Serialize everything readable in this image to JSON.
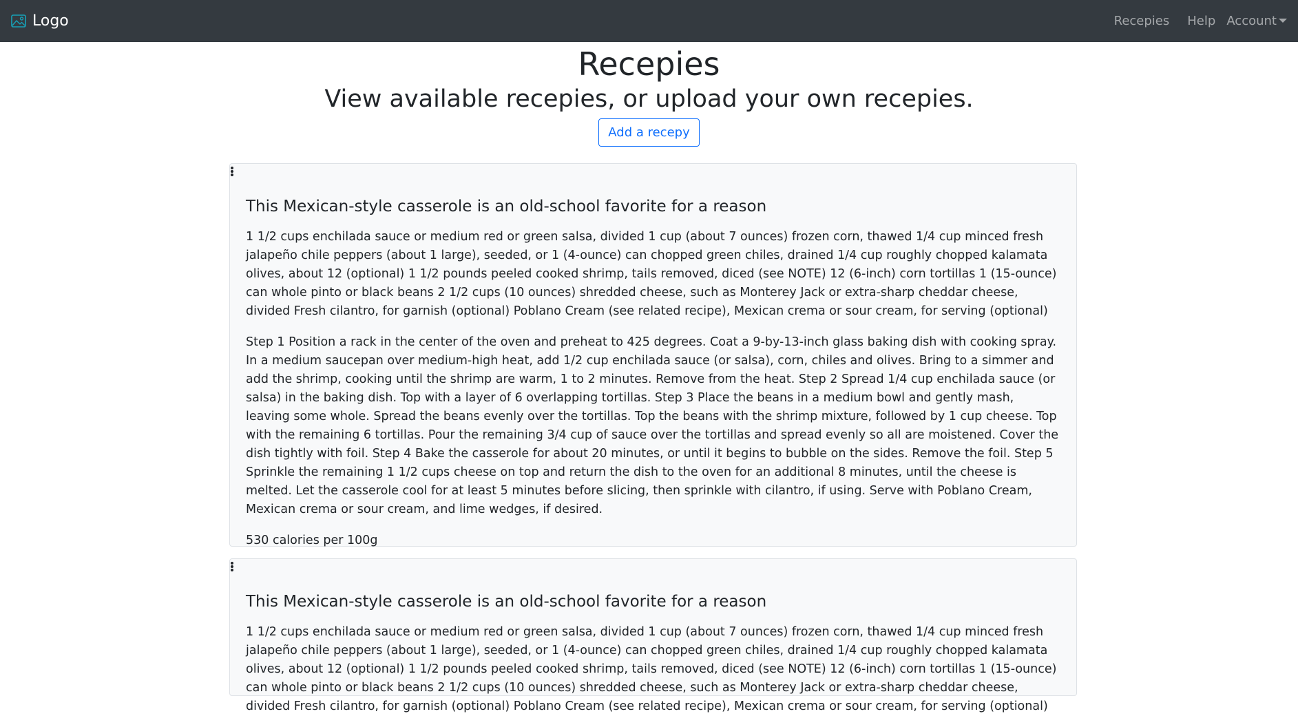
{
  "navbar": {
    "brand": "Logo",
    "links": [
      "Recepies",
      "Help",
      "Account"
    ]
  },
  "header": {
    "title": "Recepies",
    "subtitle": "View available recepies, or upload your own recepies.",
    "add_button": "Add a recepy"
  },
  "recipes": [
    {
      "title": "This Mexican-style casserole is an old-school favorite for a reason",
      "ingredients": "1 1/2 cups enchilada sauce or medium red or green salsa, divided 1 cup (about 7 ounces) frozen corn, thawed 1/4 cup minced fresh jalapeño chile peppers (about 1 large), seeded, or 1 (4-ounce) can chopped green chiles, drained 1/4 cup roughly chopped kalamata olives, about 12 (optional) 1 1/2 pounds peeled cooked shrimp, tails removed, diced (see NOTE) 12 (6-inch) corn tortillas 1 (15-ounce) can whole pinto or black beans 2 1/2 cups (10 ounces) shredded cheese, such as Monterey Jack or extra-sharp cheddar cheese, divided Fresh cilantro, for garnish (optional) Poblano Cream (see related recipe), Mexican crema or sour cream, for serving (optional)",
      "steps": "Step 1 Position a rack in the center of the oven and preheat to 425 degrees. Coat a 9-by-13-inch glass baking dish with cooking spray. In a medium saucepan over medium-high heat, add 1/2 cup enchilada sauce (or salsa), corn, chiles and olives. Bring to a simmer and add the shrimp, cooking until the shrimp are warm, 1 to 2 minutes. Remove from the heat. Step 2 Spread 1/4 cup enchilada sauce (or salsa) in the baking dish. Top with a layer of 6 overlapping tortillas. Step 3 Place the beans in a medium bowl and gently mash, leaving some whole. Spread the beans evenly over the tortillas. Top the beans with the shrimp mixture, followed by 1 cup cheese. Top with the remaining 6 tortillas. Pour the remaining 3/4 cup of sauce over the tortillas and spread evenly so all are moistened. Cover the dish tightly with foil. Step 4 Bake the casserole for about 20 minutes, or until it begins to bubble on the sides. Remove the foil. Step 5 Sprinkle the remaining 1 1/2 cups cheese on top and return the dish to the oven for an additional 8 minutes, until the cheese is melted. Let the casserole cool for at least 5 minutes before slicing, then sprinkle with cilantro, if using. Serve with Poblano Cream, Mexican crema or sour cream, and lime wedges, if desired.",
      "calories": "530 calories per 100g"
    },
    {
      "title": "This Mexican-style casserole is an old-school favorite for a reason",
      "ingredients": "1 1/2 cups enchilada sauce or medium red or green salsa, divided 1 cup (about 7 ounces) frozen corn, thawed 1/4 cup minced fresh jalapeño chile peppers (about 1 large), seeded, or 1 (4-ounce) can chopped green chiles, drained 1/4 cup roughly chopped kalamata olives, about 12 (optional) 1 1/2 pounds peeled cooked shrimp, tails removed, diced (see NOTE) 12 (6-inch) corn tortillas 1 (15-ounce) can whole pinto or black beans 2 1/2 cups (10 ounces) shredded cheese, such as Monterey Jack or extra-sharp cheddar cheese, divided Fresh cilantro, for garnish (optional) Poblano Cream (see related recipe), Mexican crema or sour cream, for serving (optional)"
    }
  ]
}
